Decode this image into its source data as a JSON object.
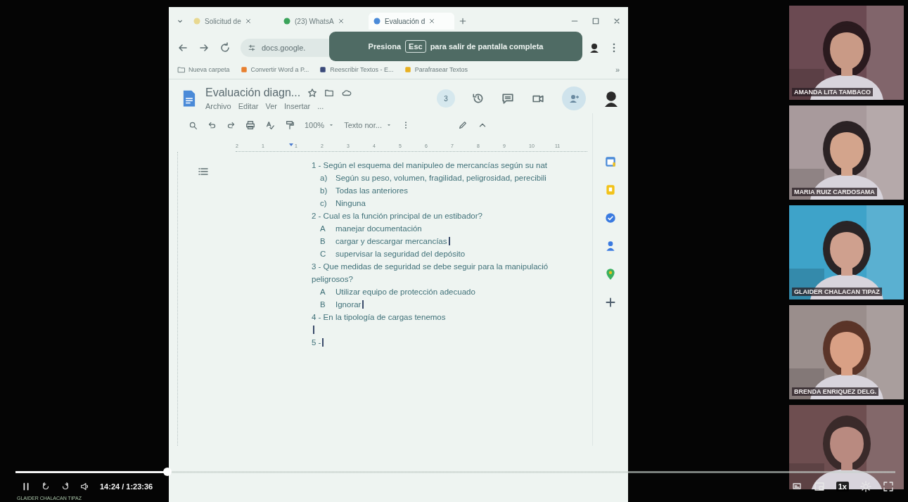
{
  "player": {
    "progress": {
      "level": 0.173
    },
    "time": "14:24 / 1:23:36",
    "caption": "GLAIDER CHALACAN TIPAZ",
    "speed": "1x"
  },
  "browser": {
    "tabs": [
      {
        "label": "Solicitud de",
        "selected": false
      },
      {
        "label": "(23) WhatsA",
        "selected": false
      },
      {
        "label": "Evaluación d",
        "selected": true
      }
    ],
    "address": "docs.google.",
    "fullscreen_toast": {
      "before": "Presiona",
      "key": "Esc",
      "after": "para salir de pantalla completa"
    },
    "bookmarks": [
      "Nueva carpeta",
      "Convertir Word a P...",
      "Reescribir Textos - E...",
      "Parafrasear Textos"
    ],
    "bookmarks_overflow": "»"
  },
  "document": {
    "title": "Evaluación diagn...",
    "menu": [
      "Archivo",
      "Editar",
      "Ver",
      "Insertar",
      "..."
    ],
    "collaborators": "3",
    "zoom": "100%",
    "style": "Texto nor...",
    "ruler": [
      "2",
      "1",
      "1",
      "2",
      "3",
      "4",
      "5",
      "6",
      "7",
      "8",
      "9",
      "10",
      "11"
    ],
    "lines": [
      {
        "kind": "question",
        "text": "1 - Según el esquema del manipuleo de mercancías según su nat",
        "cursor": false
      },
      {
        "kind": "option",
        "marker": "a)",
        "text": "Según su peso, volumen, fragilidad, peligrosidad, perecibili",
        "cursor": false
      },
      {
        "kind": "option",
        "marker": "b)",
        "text": "Todas las anteriores",
        "cursor": false
      },
      {
        "kind": "option",
        "marker": "c)",
        "text": "Ninguna",
        "cursor": false
      },
      {
        "kind": "question",
        "text": "2 - Cual es la función principal de un estibador?",
        "cursor": false
      },
      {
        "kind": "option",
        "marker": "A",
        "text": "manejar documentación",
        "cursor": false
      },
      {
        "kind": "option",
        "marker": "B",
        "text": "cargar y descargar mercancías",
        "cursor": true
      },
      {
        "kind": "option",
        "marker": "C",
        "text": "supervisar la seguridad del depósito",
        "cursor": false
      },
      {
        "kind": "question",
        "text": "3 - Que medidas de seguridad se debe seguir para la manipulació",
        "cursor": false
      },
      {
        "kind": "question",
        "text": "peligrosos?",
        "cursor": false
      },
      {
        "kind": "option",
        "marker": "A",
        "text": "Utilizar equipo de protección adecuado",
        "cursor": false
      },
      {
        "kind": "option",
        "marker": "B",
        "text": "Ignorar",
        "cursor": true
      },
      {
        "kind": "question",
        "text": "4 - En la tipología de cargas tenemos",
        "cursor": false
      },
      {
        "kind": "empty",
        "cursor": true
      },
      {
        "kind": "question",
        "text": "5 -",
        "cursor": true
      }
    ]
  },
  "participants": [
    {
      "kind": "camera",
      "name": "AMANDA LITA TAMBACO"
    },
    {
      "kind": "camera",
      "name": "MARIA RUIZ CARDOSAMA"
    },
    {
      "kind": "camera",
      "name": "GLAIDER CHALACAN TIPAZ"
    },
    {
      "kind": "camera",
      "name": "BRENDA ENRIQUEZ DELG."
    },
    {
      "kind": "picture"
    }
  ]
}
